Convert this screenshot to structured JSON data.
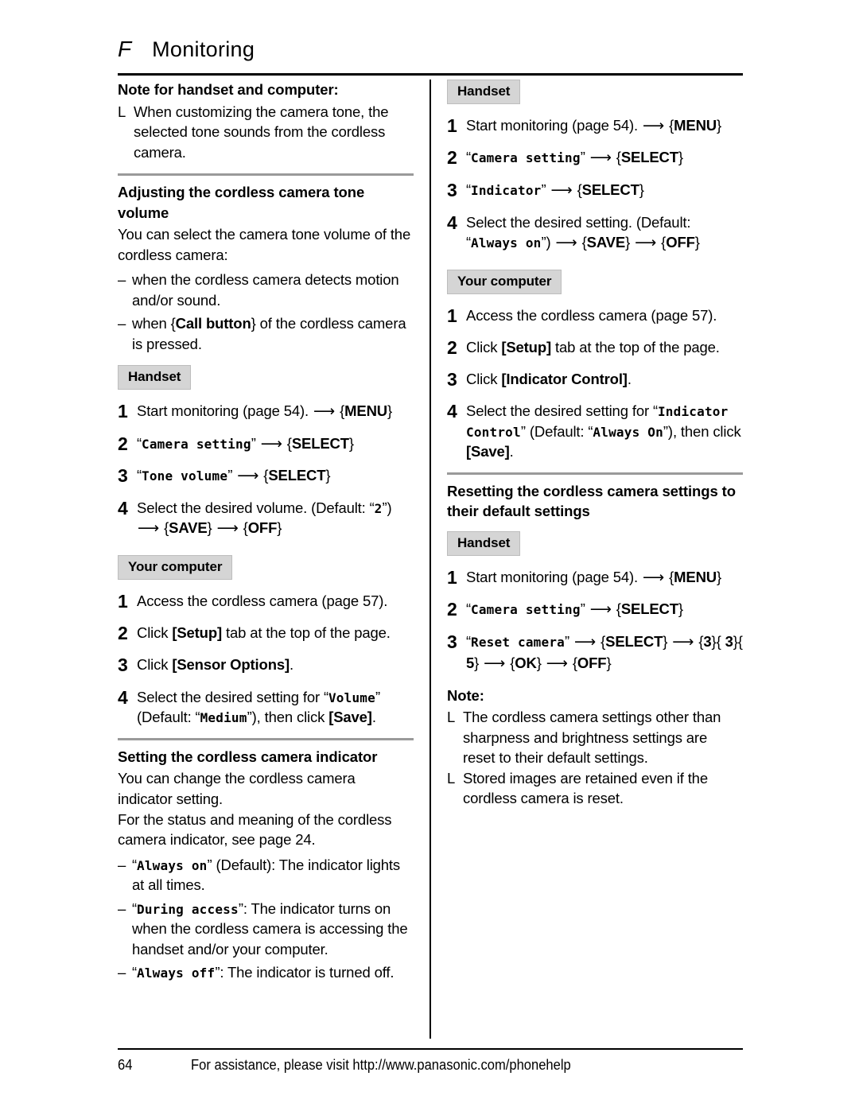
{
  "header": {
    "icon_glyph": "F",
    "icon_name": "monitoring-section-icon",
    "title": "Monitoring"
  },
  "footer": {
    "page_number": "64",
    "assistance_text": "For assistance, please visit http://www.panasonic.com/phonehelp"
  },
  "tags": {
    "handset": "Handset",
    "your_computer": "Your computer"
  },
  "left_column": {
    "note_heading": "Note for handset and computer:",
    "note_bullet_mark": "L",
    "note_bullet_text": "When customizing the camera tone, the selected tone sounds from the cordless camera.",
    "section1": {
      "heading": "Adjusting the cordless camera tone volume",
      "intro": "You can select the camera tone volume of the cordless camera:",
      "dash_mark": "–",
      "dash_items": [
        {
          "pre": "when the cordless camera detects motion and/or sound.",
          "key": "",
          "post": ""
        },
        {
          "pre": "when {",
          "key": "Call button",
          "post": "} of the cordless camera is pressed."
        }
      ],
      "handset_steps": [
        {
          "num": "1",
          "segments": [
            {
              "type": "text",
              "value": "Start monitoring (page 54). "
            },
            {
              "type": "arrow",
              "value": "⟶"
            },
            {
              "type": "text",
              "value": " {"
            },
            {
              "type": "key",
              "value": "MENU"
            },
            {
              "type": "text",
              "value": "}"
            }
          ]
        },
        {
          "num": "2",
          "segments": [
            {
              "type": "text",
              "value": "“"
            },
            {
              "type": "lcd",
              "value": "Camera setting"
            },
            {
              "type": "text",
              "value": "” "
            },
            {
              "type": "arrow",
              "value": "⟶"
            },
            {
              "type": "text",
              "value": " {"
            },
            {
              "type": "key",
              "value": "SELECT"
            },
            {
              "type": "text",
              "value": "}"
            }
          ]
        },
        {
          "num": "3",
          "segments": [
            {
              "type": "text",
              "value": "“"
            },
            {
              "type": "lcd",
              "value": "Tone volume"
            },
            {
              "type": "text",
              "value": "” "
            },
            {
              "type": "arrow",
              "value": "⟶"
            },
            {
              "type": "text",
              "value": " {"
            },
            {
              "type": "key",
              "value": "SELECT"
            },
            {
              "type": "text",
              "value": "}"
            }
          ]
        },
        {
          "num": "4",
          "segments": [
            {
              "type": "text",
              "value": "Select the desired volume. (Default: “"
            },
            {
              "type": "lcd",
              "value": "2"
            },
            {
              "type": "text",
              "value": "”) "
            },
            {
              "type": "arrow",
              "value": "⟶"
            },
            {
              "type": "text",
              "value": " {"
            },
            {
              "type": "key",
              "value": "SAVE"
            },
            {
              "type": "text",
              "value": "} "
            },
            {
              "type": "arrow",
              "value": "⟶"
            },
            {
              "type": "text",
              "value": " {"
            },
            {
              "type": "key",
              "value": "OFF"
            },
            {
              "type": "text",
              "value": "}"
            }
          ]
        }
      ],
      "computer_steps": [
        {
          "num": "1",
          "segments": [
            {
              "type": "text",
              "value": "Access the cordless camera (page 57)."
            }
          ]
        },
        {
          "num": "2",
          "segments": [
            {
              "type": "text",
              "value": "Click "
            },
            {
              "type": "ui",
              "value": "[Setup]"
            },
            {
              "type": "text",
              "value": " tab at the top of the page."
            }
          ]
        },
        {
          "num": "3",
          "segments": [
            {
              "type": "text",
              "value": "Click "
            },
            {
              "type": "ui",
              "value": "[Sensor Options]"
            },
            {
              "type": "text",
              "value": "."
            }
          ]
        },
        {
          "num": "4",
          "segments": [
            {
              "type": "text",
              "value": "Select the desired setting for “"
            },
            {
              "type": "lcd",
              "value": "Volume"
            },
            {
              "type": "text",
              "value": "” (Default: “"
            },
            {
              "type": "lcd",
              "value": "Medium"
            },
            {
              "type": "text",
              "value": "”), then click "
            },
            {
              "type": "ui",
              "value": "[Save]"
            },
            {
              "type": "text",
              "value": "."
            }
          ]
        }
      ]
    },
    "section2": {
      "heading": "Setting the cordless camera indicator",
      "para1": "You can change the cordless camera indicator setting.",
      "para2": "For the status and meaning of the cordless camera indicator, see page 24.",
      "dash_mark": "–",
      "options": [
        {
          "lcd": "Always on",
          "text": " (Default): The indicator lights at all times."
        },
        {
          "lcd": "During access",
          "text": ": The indicator turns on when the cordless camera is accessing the handset and/or your computer."
        },
        {
          "lcd": "Always off",
          "text": ": The indicator is turned off."
        }
      ]
    }
  },
  "right_column": {
    "indicator_handset_steps": [
      {
        "num": "1",
        "segments": [
          {
            "type": "text",
            "value": "Start monitoring (page 54). "
          },
          {
            "type": "arrow",
            "value": "⟶"
          },
          {
            "type": "text",
            "value": " {"
          },
          {
            "type": "key",
            "value": "MENU"
          },
          {
            "type": "text",
            "value": "}"
          }
        ]
      },
      {
        "num": "2",
        "segments": [
          {
            "type": "text",
            "value": "“"
          },
          {
            "type": "lcd",
            "value": "Camera setting"
          },
          {
            "type": "text",
            "value": "” "
          },
          {
            "type": "arrow",
            "value": "⟶"
          },
          {
            "type": "text",
            "value": " {"
          },
          {
            "type": "key",
            "value": "SELECT"
          },
          {
            "type": "text",
            "value": "}"
          }
        ]
      },
      {
        "num": "3",
        "segments": [
          {
            "type": "text",
            "value": "“"
          },
          {
            "type": "lcd",
            "value": "Indicator"
          },
          {
            "type": "text",
            "value": "” "
          },
          {
            "type": "arrow",
            "value": "⟶"
          },
          {
            "type": "text",
            "value": " {"
          },
          {
            "type": "key",
            "value": "SELECT"
          },
          {
            "type": "text",
            "value": "}"
          }
        ]
      },
      {
        "num": "4",
        "segments": [
          {
            "type": "text",
            "value": "Select the desired setting. (Default: “"
          },
          {
            "type": "lcd",
            "value": "Always on"
          },
          {
            "type": "text",
            "value": "”) "
          },
          {
            "type": "arrow",
            "value": "⟶"
          },
          {
            "type": "text",
            "value": " {"
          },
          {
            "type": "key",
            "value": "SAVE"
          },
          {
            "type": "text",
            "value": "} "
          },
          {
            "type": "arrow",
            "value": "⟶"
          },
          {
            "type": "text",
            "value": " {"
          },
          {
            "type": "key",
            "value": "OFF"
          },
          {
            "type": "text",
            "value": "}"
          }
        ]
      }
    ],
    "indicator_computer_steps": [
      {
        "num": "1",
        "segments": [
          {
            "type": "text",
            "value": "Access the cordless camera (page 57)."
          }
        ]
      },
      {
        "num": "2",
        "segments": [
          {
            "type": "text",
            "value": "Click "
          },
          {
            "type": "ui",
            "value": "[Setup]"
          },
          {
            "type": "text",
            "value": " tab at the top of the page."
          }
        ]
      },
      {
        "num": "3",
        "segments": [
          {
            "type": "text",
            "value": "Click "
          },
          {
            "type": "ui",
            "value": "[Indicator Control]"
          },
          {
            "type": "text",
            "value": "."
          }
        ]
      },
      {
        "num": "4",
        "segments": [
          {
            "type": "text",
            "value": "Select the desired setting for “"
          },
          {
            "type": "lcd",
            "value": "Indicator Control"
          },
          {
            "type": "text",
            "value": "” (Default: “"
          },
          {
            "type": "lcd",
            "value": "Always On"
          },
          {
            "type": "text",
            "value": "”), then click "
          },
          {
            "type": "ui",
            "value": "[Save]"
          },
          {
            "type": "text",
            "value": "."
          }
        ]
      }
    ],
    "reset_section": {
      "heading": "Resetting the cordless camera settings to their default settings",
      "steps": [
        {
          "num": "1",
          "segments": [
            {
              "type": "text",
              "value": "Start monitoring (page 54). "
            },
            {
              "type": "arrow",
              "value": "⟶"
            },
            {
              "type": "text",
              "value": " {"
            },
            {
              "type": "key",
              "value": "MENU"
            },
            {
              "type": "text",
              "value": "}"
            }
          ]
        },
        {
          "num": "2",
          "segments": [
            {
              "type": "text",
              "value": "“"
            },
            {
              "type": "lcd",
              "value": "Camera setting"
            },
            {
              "type": "text",
              "value": "” "
            },
            {
              "type": "arrow",
              "value": "⟶"
            },
            {
              "type": "text",
              "value": " {"
            },
            {
              "type": "key",
              "value": "SELECT"
            },
            {
              "type": "text",
              "value": "}"
            }
          ]
        },
        {
          "num": "3",
          "segments": [
            {
              "type": "text",
              "value": "“"
            },
            {
              "type": "lcd",
              "value": "Reset camera"
            },
            {
              "type": "text",
              "value": "” "
            },
            {
              "type": "arrow",
              "value": "⟶"
            },
            {
              "type": "text",
              "value": " {"
            },
            {
              "type": "key",
              "value": "SELECT"
            },
            {
              "type": "text",
              "value": "} "
            },
            {
              "type": "arrow",
              "value": "⟶"
            },
            {
              "type": "text",
              "value": " {"
            },
            {
              "type": "key",
              "value": "3"
            },
            {
              "type": "text",
              "value": "}{"
            },
            {
              "type": "key",
              "value": " 3"
            },
            {
              "type": "text",
              "value": "}{"
            },
            {
              "type": "key",
              "value": " 5"
            },
            {
              "type": "text",
              "value": "} "
            },
            {
              "type": "arrow",
              "value": "⟶"
            },
            {
              "type": "text",
              "value": " {"
            },
            {
              "type": "key",
              "value": "OK"
            },
            {
              "type": "text",
              "value": "} "
            },
            {
              "type": "arrow",
              "value": "⟶"
            },
            {
              "type": "text",
              "value": " {"
            },
            {
              "type": "key",
              "value": "OFF"
            },
            {
              "type": "text",
              "value": "}"
            }
          ]
        }
      ],
      "note_heading": "Note:",
      "note_bullet_mark": "L",
      "notes": [
        "The cordless camera settings other than sharpness and brightness settings are reset to their default settings.",
        "Stored images are retained even if the cordless camera is reset."
      ]
    }
  }
}
